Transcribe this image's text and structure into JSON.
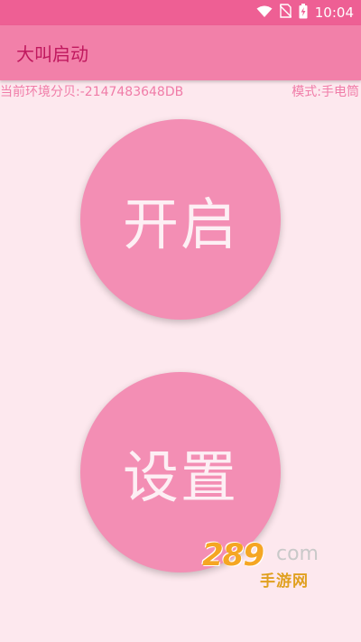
{
  "status_bar": {
    "time": "10:04",
    "icons": [
      "wifi-icon",
      "no-sim-icon",
      "battery-charging-icon"
    ]
  },
  "app_bar": {
    "title": "大叫启动"
  },
  "info": {
    "decibel_text": "当前环境分贝:-2147483648DB",
    "mode_text": "模式:手电筒"
  },
  "buttons": {
    "start_label": "开启",
    "settings_label": "设置"
  },
  "watermark": {
    "main": "289",
    "com": "com",
    "sub": "手游网"
  },
  "colors": {
    "status_bar": "#EE5F94",
    "app_bar": "#F280A9",
    "background": "#FDE8EE",
    "button": "#F38EB4",
    "info_text": "#F07CA8",
    "title_text": "#C0185E"
  }
}
